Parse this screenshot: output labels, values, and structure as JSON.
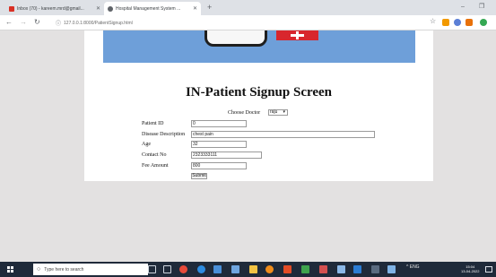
{
  "browser": {
    "tabs": [
      {
        "label": "Inbox (70) - kareem.mrd@gmail...",
        "icon": "gmail-icon",
        "color": "#d93025"
      },
      {
        "label": "Hospital Management System ...",
        "icon": "globe-icon",
        "color": "#5f6368"
      }
    ],
    "new_tab_label": "+",
    "url": "127.0.0.1:8000/PatientSignup.html",
    "window_controls": {
      "minimize": "–",
      "maximize": "❐"
    }
  },
  "page": {
    "title": "IN-Patient Signup Screen",
    "choose_doctor_label": "Choose Doctor",
    "choose_doctor_value": "raju",
    "fields": [
      {
        "label": "Patient ID",
        "value": "0"
      },
      {
        "label": "Disease Description",
        "value": "chest pain"
      },
      {
        "label": "Age",
        "value": "32"
      },
      {
        "label": "Contact No",
        "value": "2323333111"
      },
      {
        "label": "Fee Amount",
        "value": "800"
      }
    ],
    "submit_label": "Submit"
  },
  "taskbar": {
    "search_placeholder": "Type here to search",
    "tray_text": "^ ENG",
    "clock_time": "15:04",
    "clock_date": "13-04-2022"
  },
  "colors": {
    "banner": "#6e9fd9",
    "taskbar": "#1f2a3a",
    "page_bg": "#e3e1e1",
    "medbox": "#d8262d"
  }
}
